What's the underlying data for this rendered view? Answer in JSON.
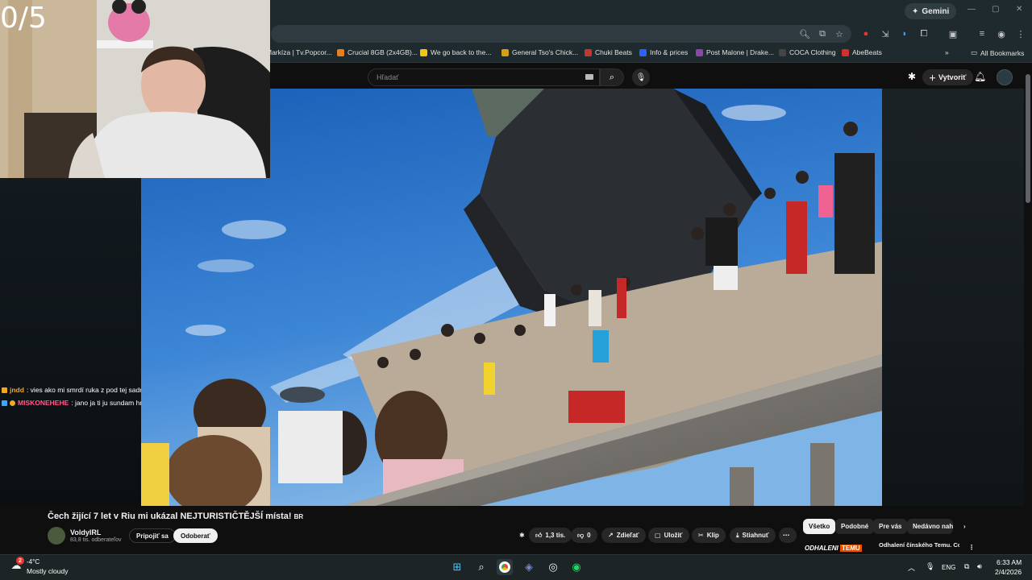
{
  "counter": "0/5",
  "gemini_label": "Gemini",
  "bookmarks": [
    {
      "label": "Markíza | Tv.Popcor...",
      "color": "#c0392b"
    },
    {
      "label": "Crucial 8GB (2x4GB)...",
      "color": "#e67e22"
    },
    {
      "label": "We go back to the...",
      "color": "#f1c40f"
    },
    {
      "label": "General Tso's Chick...",
      "color": "#d4a017"
    },
    {
      "label": "Chuki Beats",
      "color": "#c0392b"
    },
    {
      "label": "Info & prices",
      "color": "#2962ff"
    },
    {
      "label": "Post Malone | Drake...",
      "color": "#8e44ad"
    },
    {
      "label": "COCA Clothing",
      "color": "#444444"
    },
    {
      "label": "AbeBeats",
      "color": "#d32f2f"
    }
  ],
  "all_bookmarks": "All Bookmarks",
  "yt": {
    "search_placeholder": "Hľadať",
    "create_label": "Vytvoriť"
  },
  "chat": [
    {
      "user": "jndd",
      "message": ": vies ako mi smrdí ruka z pod tej sadr",
      "color": "#f5a623"
    },
    {
      "user": "MISKONEHEHE",
      "message": ": jano ja ti ju sundam hned",
      "color": "#ff5c8a"
    }
  ],
  "video": {
    "title": "Čech žijící 7 let v Riu mi ukázal NEJTURISTIČTĚJŠÍ místa!",
    "title_tag": "BR",
    "channel": "VoldyIRL",
    "subscribers": "83,8 tis. odberateľov",
    "join_label": "Pripojiť sa",
    "subscribe_label": "Odoberať",
    "likes": "1,3 tis.",
    "dislikes": "0",
    "share_label": "Zdieľať",
    "save_label": "Uložiť",
    "clip_label": "Klip",
    "download_label": "Stiahnuť"
  },
  "chips": [
    "Všetko",
    "Podobné",
    "Pre vás",
    "Nedávno nahr..."
  ],
  "recommendation": {
    "thumb_text": "ODHALENI",
    "thumb_brand": "TEMU",
    "title": "Odhalení čínského Temu. Co"
  },
  "taskbar": {
    "temperature": "-4°C",
    "weather": "Mostly cloudy",
    "notification_count": "2",
    "lang": "ENG",
    "time": "6:33 AM",
    "date": "2/4/2026"
  }
}
